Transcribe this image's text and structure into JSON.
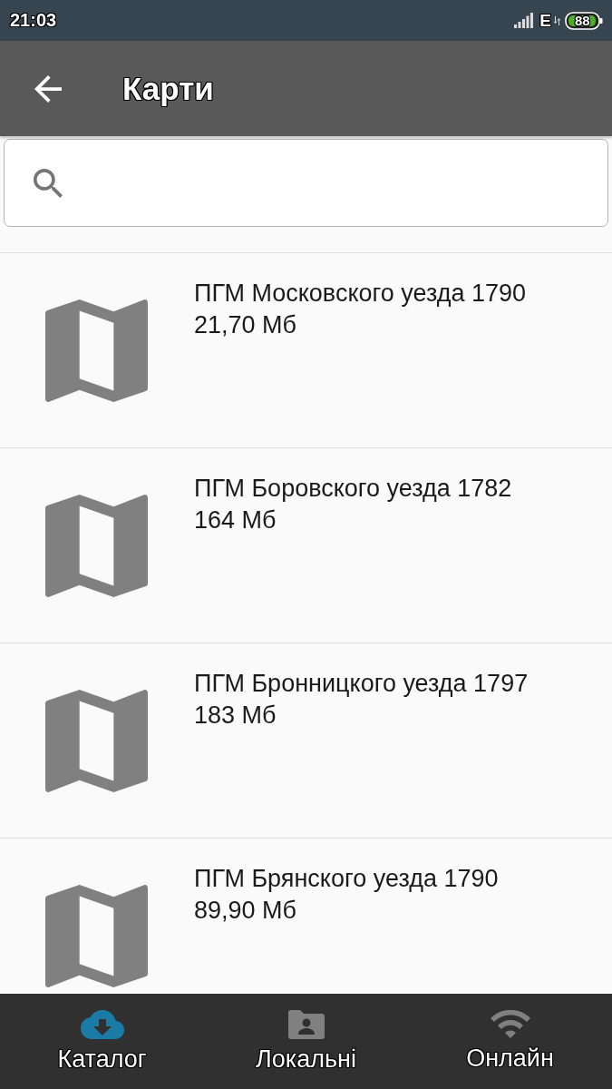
{
  "status_bar": {
    "time": "21:03",
    "network_type": "E",
    "battery": "88"
  },
  "app_bar": {
    "title": "Карти"
  },
  "maps": [
    {
      "title": "ПГМ Московского уезда 1790",
      "size": "21,70 Мб"
    },
    {
      "title": "ПГМ Боровского уезда 1782",
      "size": "164 Мб"
    },
    {
      "title": "ПГМ Бронницкого уезда 1797",
      "size": "183 Мб"
    },
    {
      "title": "ПГМ Брянского уезда 1790",
      "size": "89,90 Мб"
    }
  ],
  "bottom_nav": [
    {
      "label": "Каталог",
      "selected": true
    },
    {
      "label": "Локальні",
      "selected": false
    },
    {
      "label": "Онлайн",
      "selected": false
    }
  ]
}
